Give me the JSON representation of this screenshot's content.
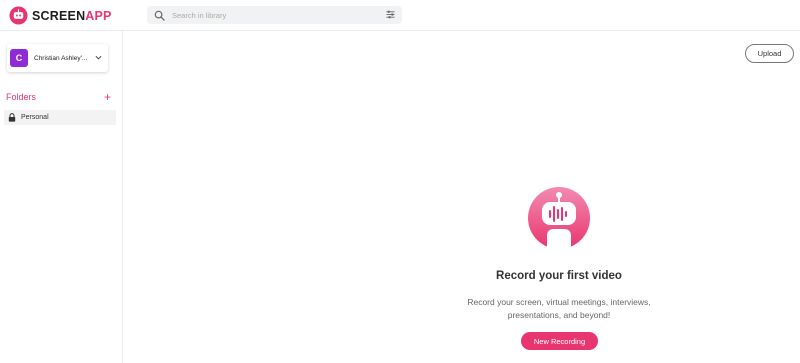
{
  "app": {
    "logo_part1": "SCREEN",
    "logo_part2": "APP",
    "accent_color": "#e9356f"
  },
  "search": {
    "placeholder": "Search in library",
    "icon": "search-icon",
    "filter_icon": "sliders-icon"
  },
  "account": {
    "avatar_letter": "C",
    "avatar_color": "#8e2ad6",
    "name": "Christian Ashley'..."
  },
  "sidebar": {
    "folders_title": "Folders",
    "add_label": "+",
    "items": [
      {
        "label": "Personal",
        "icon": "lock-icon"
      }
    ]
  },
  "toolbar": {
    "upload_label": "Upload"
  },
  "empty_state": {
    "illustration": "robot-recording-icon",
    "title": "Record your first video",
    "desc_line1": "Record your screen, virtual meetings, interviews,",
    "desc_line2": "presentations, and beyond!",
    "cta_label": "New Recording"
  }
}
